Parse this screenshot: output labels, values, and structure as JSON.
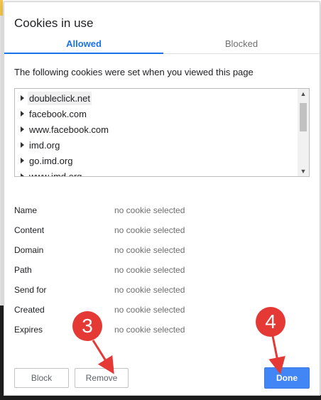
{
  "dialog": {
    "title": "Cookies in use"
  },
  "tabs": [
    {
      "label": "Allowed",
      "selected": true
    },
    {
      "label": "Blocked",
      "selected": false
    }
  ],
  "description": "The following cookies were set when you viewed this page",
  "cookies": [
    "doubleclick.net",
    "facebook.com",
    "www.facebook.com",
    "imd.org",
    "go.imd.org",
    "www.imd.org"
  ],
  "details": [
    {
      "label": "Name",
      "value": "no cookie selected"
    },
    {
      "label": "Content",
      "value": "no cookie selected"
    },
    {
      "label": "Domain",
      "value": "no cookie selected"
    },
    {
      "label": "Path",
      "value": "no cookie selected"
    },
    {
      "label": "Send for",
      "value": "no cookie selected"
    },
    {
      "label": "Created",
      "value": "no cookie selected"
    },
    {
      "label": "Expires",
      "value": "no cookie selected"
    }
  ],
  "buttons": {
    "block": "Block",
    "remove": "Remove",
    "done": "Done"
  },
  "annotations": {
    "step3": "3",
    "step4": "4"
  },
  "colors": {
    "accent": "#1a73e8",
    "primary_button": "#4285f4",
    "callout": "#e53935"
  }
}
